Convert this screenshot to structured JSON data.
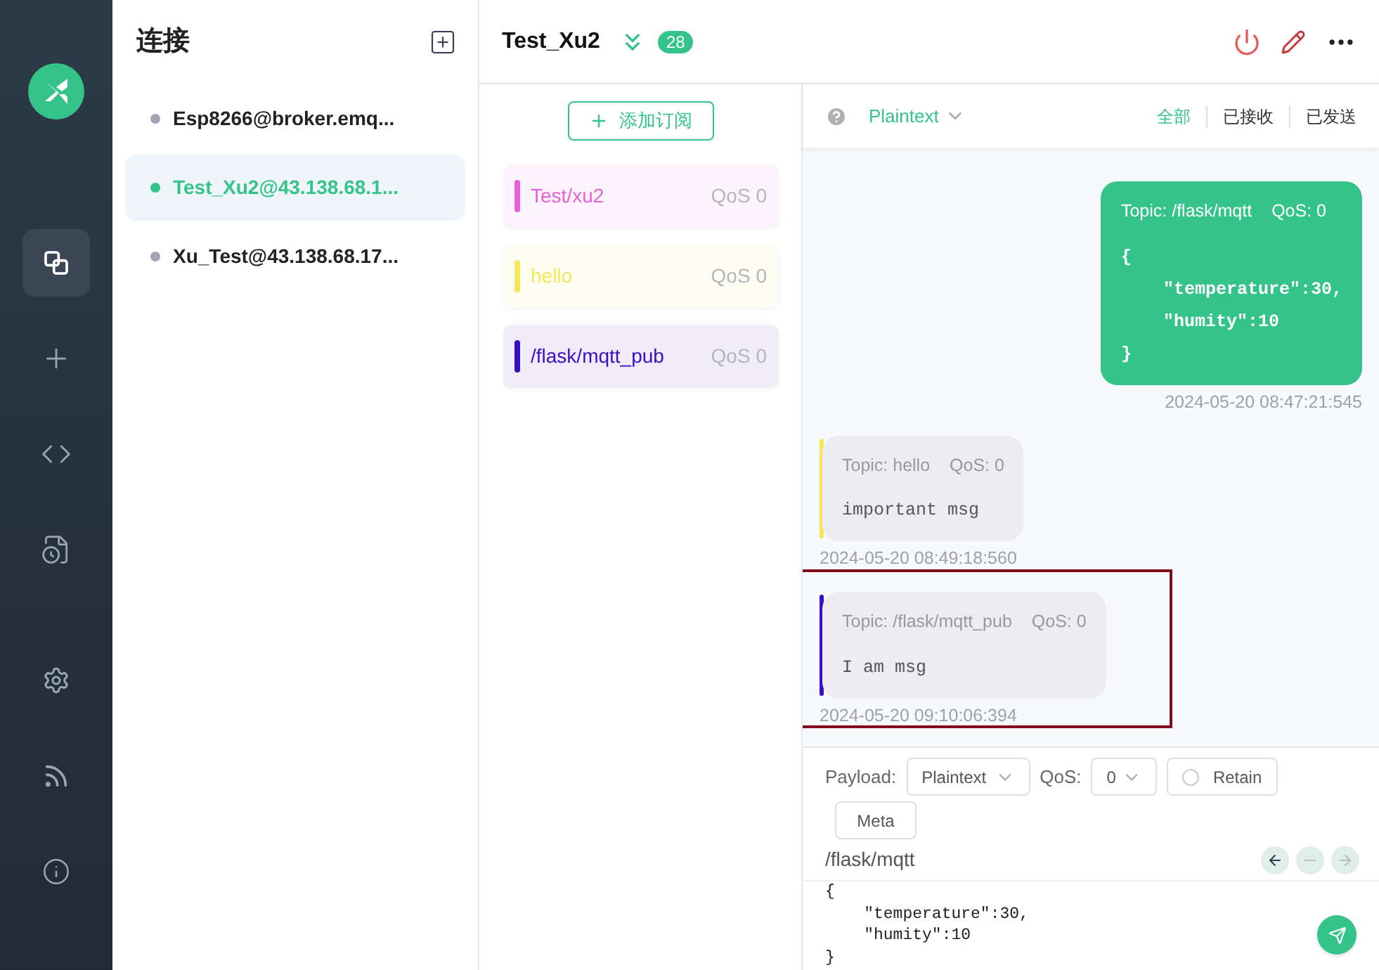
{
  "nav_items": [
    {
      "kind": "connections",
      "selected": true
    },
    {
      "kind": "new",
      "selected": false
    },
    {
      "kind": "script",
      "selected": false
    },
    {
      "kind": "log",
      "selected": false
    },
    {
      "kind": "settings",
      "selected": false
    },
    {
      "kind": "feed",
      "selected": false
    },
    {
      "kind": "about",
      "selected": false
    }
  ],
  "connections": {
    "title": "连接",
    "items": [
      {
        "name": "Esp8266@broker.emq...",
        "selected": false,
        "color": "#a1a5b3"
      },
      {
        "name": "Test_Xu2@43.138.68.1...",
        "selected": true,
        "color": "#34c388"
      },
      {
        "name": "Xu_Test@43.138.68.17...",
        "selected": false,
        "color": "#a1a5b3"
      }
    ]
  },
  "header": {
    "title": "Test_Xu2",
    "badge": "28"
  },
  "subscriptions": {
    "add_button": "添加订阅",
    "items": [
      {
        "topic": "Test/xu2",
        "qos": "QoS 0",
        "color": "#e562d8"
      },
      {
        "topic": "hello",
        "qos": "QoS 0",
        "color": "#f5e65a"
      },
      {
        "topic": "/flask/mqtt_pub",
        "qos": "QoS 0",
        "color": "#3a0fc4"
      }
    ]
  },
  "message_toolbar": {
    "format": "Plaintext",
    "filters": [
      {
        "label": "全部",
        "selected": true
      },
      {
        "label": "已接收",
        "selected": false
      },
      {
        "label": "已发送",
        "selected": false
      }
    ]
  },
  "messages": [
    {
      "kind": "sent",
      "topic": "Topic: /flask/mqtt",
      "qos": "QoS: 0",
      "payload": [
        "{",
        "    \"temperature\":30,",
        "    \"humity\":10",
        "}"
      ],
      "time": "2024-05-20 08:47:21:545",
      "highlighted": false
    },
    {
      "kind": "received",
      "color": "#f5e65a",
      "topic": "Topic: hello",
      "qos": "QoS: 0",
      "payload": [
        "important msg"
      ],
      "time": "2024-05-20 08:49:18:560",
      "highlighted": false
    },
    {
      "kind": "received",
      "color": "#3a0fc4",
      "topic": "Topic: /flask/mqtt_pub",
      "qos": "QoS: 0",
      "payload": [
        "I am msg"
      ],
      "time": "2024-05-20 09:10:06:394",
      "highlighted": true
    }
  ],
  "composer": {
    "payload_label": "Payload:",
    "payload_format": "Plaintext",
    "qos_label": "QoS:",
    "qos": "0",
    "retain": {
      "label": "Retain",
      "checked": false
    },
    "meta": "Meta",
    "topic": "/flask/mqtt",
    "editor": [
      "{",
      "    \"temperature\":30,",
      "    \"humity\":10",
      "}"
    ]
  }
}
